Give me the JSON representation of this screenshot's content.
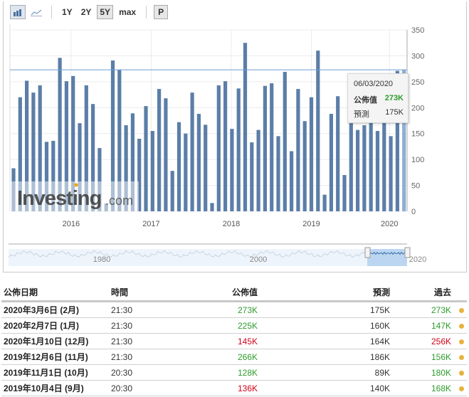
{
  "toolbar": {
    "bar_icon": "bar-chart-icon",
    "line_icon": "line-chart-icon",
    "ranges": [
      "1Y",
      "2Y",
      "5Y",
      "max"
    ],
    "active_range": "5Y",
    "p_label": "P"
  },
  "watermark": "Investing.com",
  "colors": {
    "bar": "#5b7ea8",
    "bar_hover": "#8eaed3",
    "line": "#6a9fd0",
    "positive": "#2d9c2d",
    "negative": "#d0021b",
    "dot": "#e8b23c"
  },
  "tooltip": {
    "date": "06/03/2020",
    "actual_label": "公佈值",
    "actual": "273K",
    "forecast_label": "預測",
    "forecast": "175K"
  },
  "chart_data": {
    "type": "bar",
    "values": [
      83,
      220,
      252,
      229,
      243,
      134,
      136,
      296,
      251,
      261,
      170,
      243,
      207,
      122,
      15,
      291,
      273,
      166,
      189,
      140,
      203,
      155,
      236,
      218,
      78,
      172,
      150,
      229,
      188,
      167,
      16,
      243,
      251,
      159,
      237,
      325,
      133,
      157,
      242,
      247,
      145,
      269,
      116,
      236,
      174,
      220,
      310,
      32,
      188,
      222,
      70,
      170,
      157,
      166,
      178,
      155,
      180,
      145,
      271,
      273
    ],
    "x_tick_labels": [
      "2016",
      "2017",
      "2018",
      "2019",
      "2020"
    ],
    "y_ticks": [
      0,
      50,
      100,
      150,
      200,
      250,
      300,
      350
    ],
    "ylim": [
      0,
      350
    ],
    "reference_line": 273,
    "grid": true,
    "navigator_labels": [
      "1980",
      "2000",
      "2020"
    ]
  },
  "table": {
    "headers": [
      "公佈日期",
      "時間",
      "公佈值",
      "預測",
      "過去"
    ],
    "rows": [
      {
        "date": "2020年3月6日 (2月)",
        "time": "21:30",
        "actual": "273K",
        "actual_cls": "pos",
        "forecast": "175K",
        "previous": "273K",
        "previous_cls": "pos"
      },
      {
        "date": "2020年2月7日 (1月)",
        "time": "21:30",
        "actual": "225K",
        "actual_cls": "pos",
        "forecast": "160K",
        "previous": "147K",
        "previous_cls": "pos"
      },
      {
        "date": "2020年1月10日 (12月)",
        "time": "21:30",
        "actual": "145K",
        "actual_cls": "neg",
        "forecast": "164K",
        "previous": "256K",
        "previous_cls": "neg"
      },
      {
        "date": "2019年12月6日 (11月)",
        "time": "21:30",
        "actual": "266K",
        "actual_cls": "pos",
        "forecast": "186K",
        "previous": "156K",
        "previous_cls": "pos"
      },
      {
        "date": "2019年11月1日 (10月)",
        "time": "20:30",
        "actual": "128K",
        "actual_cls": "pos",
        "forecast": "89K",
        "previous": "180K",
        "previous_cls": "pos"
      },
      {
        "date": "2019年10月4日 (9月)",
        "time": "20:30",
        "actual": "136K",
        "actual_cls": "neg",
        "forecast": "140K",
        "previous": "168K",
        "previous_cls": "pos"
      }
    ]
  }
}
